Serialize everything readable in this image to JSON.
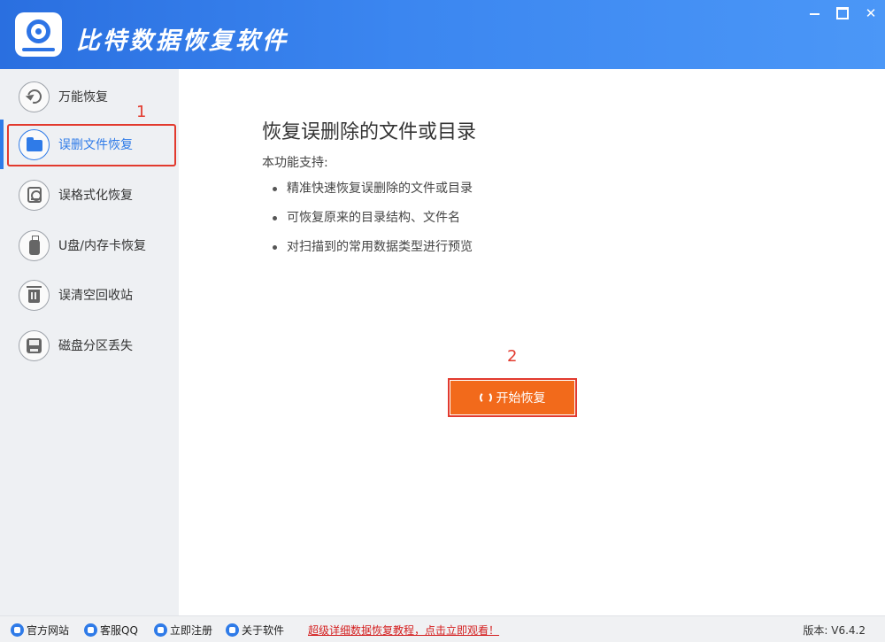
{
  "window": {
    "title": "比特数据恢复软件",
    "minimize_icon": "minimize-icon",
    "maximize_icon": "maximize-icon",
    "close_label": "✕"
  },
  "sidebar": {
    "items": [
      {
        "label": "万能恢复",
        "icon": "undo-icon"
      },
      {
        "label": "误删文件恢复",
        "icon": "folder-icon",
        "active": true
      },
      {
        "label": "误格式化恢复",
        "icon": "formatted-disk-icon"
      },
      {
        "label": "U盘/内存卡恢复",
        "icon": "usb-drive-icon"
      },
      {
        "label": "误清空回收站",
        "icon": "trash-icon"
      },
      {
        "label": "磁盘分区丢失",
        "icon": "disk-partition-icon"
      }
    ]
  },
  "annotations": {
    "marker_1": "1",
    "marker_2": "2",
    "highlight_color": "#e23a2e"
  },
  "main": {
    "title": "恢复误删除的文件或目录",
    "subtitle": "本功能支持:",
    "features": [
      "精准快速恢复误删除的文件或目录",
      "可恢复原来的目录结构、文件名",
      "对扫描到的常用数据类型进行预览"
    ],
    "start_button": "开始恢复"
  },
  "statusbar": {
    "links": [
      {
        "label": "官方网站",
        "icon": "home-icon"
      },
      {
        "label": "客服QQ",
        "icon": "qq-icon"
      },
      {
        "label": "立即注册",
        "icon": "register-icon"
      },
      {
        "label": "关于软件",
        "icon": "info-icon"
      }
    ],
    "tutorial": "超级详细数据恢复教程，点击立即观看！",
    "version": "版本: V6.4.2"
  },
  "colors": {
    "titlebar": "#3b86f0",
    "accent": "#2f7be8",
    "start_button": "#f26a1b"
  }
}
